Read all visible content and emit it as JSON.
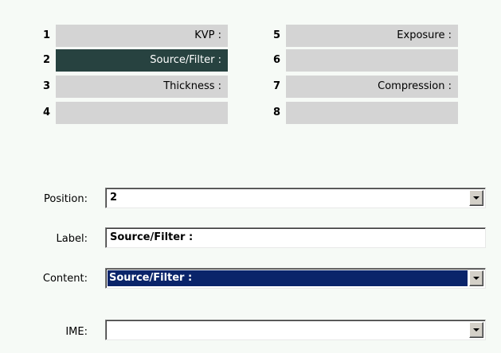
{
  "slots": [
    {
      "number": "1",
      "label": "KVP :",
      "selected": false
    },
    {
      "number": "2",
      "label": "Source/Filter :",
      "selected": true
    },
    {
      "number": "3",
      "label": "Thickness :",
      "selected": false
    },
    {
      "number": "4",
      "label": "",
      "selected": false
    },
    {
      "number": "5",
      "label": "Exposure :",
      "selected": false
    },
    {
      "number": "6",
      "label": "",
      "selected": false
    },
    {
      "number": "7",
      "label": "Compression :",
      "selected": false
    },
    {
      "number": "8",
      "label": "",
      "selected": false
    }
  ],
  "form": {
    "position": {
      "label": "Position:",
      "value": "2"
    },
    "label": {
      "label": "Label:",
      "value": "Source/Filter :"
    },
    "content": {
      "label": "Content:",
      "value": "Source/Filter :"
    },
    "ime": {
      "label": "IME:",
      "value": ""
    }
  },
  "colors": {
    "selected_slot": "#274240",
    "slot": "#d4d4d4",
    "combo_highlight": "#0a246a",
    "background": "#f6faf6"
  },
  "icons": {
    "dropdown": "chevron-down-icon"
  }
}
